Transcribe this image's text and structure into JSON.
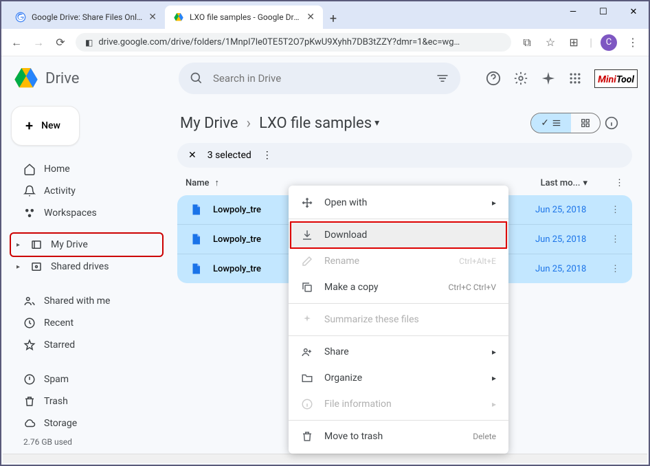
{
  "browser": {
    "tabs": [
      {
        "title": "Google Drive: Share Files Online",
        "active": false
      },
      {
        "title": "LXO file samples - Google Drive",
        "active": true
      }
    ],
    "url": "drive.google.com/drive/folders/1MnpI7le0TE5T2O7pKwU9Xyhh7DB3tZZY?dmr=1&ec=wg…",
    "avatar_initial": "C"
  },
  "drive": {
    "brand": "Drive",
    "search_placeholder": "Search in Drive",
    "new_button": "New",
    "logo": {
      "a": "Mini",
      "b": "Tool"
    }
  },
  "sidebar": {
    "home": "Home",
    "activity": "Activity",
    "workspaces": "Workspaces",
    "my_drive": "My Drive",
    "shared_drives": "Shared drives",
    "shared_with_me": "Shared with me",
    "recent": "Recent",
    "starred": "Starred",
    "spam": "Spam",
    "trash": "Trash",
    "storage": "Storage",
    "storage_used": "2.76 GB used"
  },
  "breadcrumb": {
    "root": "My Drive",
    "current": "LXO file samples"
  },
  "selection": {
    "count_text": "3 selected"
  },
  "columns": {
    "name": "Name",
    "last_modified": "Last mo..."
  },
  "files": [
    {
      "name": "Lowpoly_tre",
      "modified": "Jun 25, 2018"
    },
    {
      "name": "Lowpoly_tre",
      "modified": "Jun 25, 2018"
    },
    {
      "name": "Lowpoly_tre",
      "modified": "Jun 25, 2018"
    }
  ],
  "menu": {
    "open_with": "Open with",
    "download": "Download",
    "rename": "Rename",
    "rename_shortcut": "Ctrl+Alt+E",
    "make_copy": "Make a copy",
    "copy_shortcut": "Ctrl+C Ctrl+V",
    "summarize": "Summarize these files",
    "share": "Share",
    "organize": "Organize",
    "file_information": "File information",
    "move_to_trash": "Move to trash",
    "delete": "Delete"
  }
}
